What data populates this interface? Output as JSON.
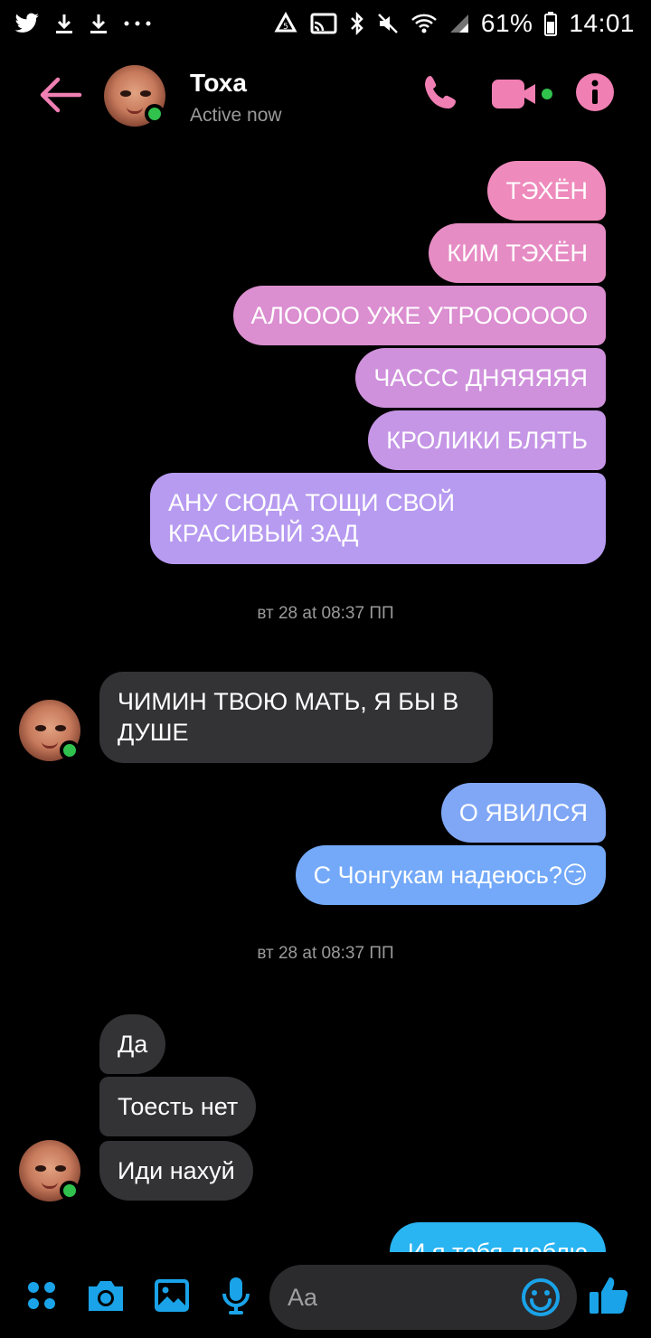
{
  "status_bar": {
    "battery": "61%",
    "time": "14:01",
    "icons": [
      "twitter-icon",
      "download-icon",
      "download-icon",
      "more-dots-icon",
      "recycle-icon",
      "cast-icon",
      "bluetooth-icon",
      "mute-icon",
      "wifi-icon",
      "signal-icon",
      "battery-icon"
    ]
  },
  "header": {
    "name": "Тоха",
    "status": "Active now"
  },
  "colors": {
    "accent": "#f07fb3",
    "incoming": "#333336",
    "online": "#31c24d",
    "composer_blue": "#1aa3e8"
  },
  "messages": {
    "m1": "ТЭХЁН",
    "m2": "КИМ ТЭХЁН",
    "m3": "АЛОООО УЖЕ УТРОООООО",
    "m4": "ЧАССС ДНЯЯЯЯЯ",
    "m5": "КРОЛИКИ БЛЯТЬ",
    "m6": "АНУ СЮДА ТОЩИ СВОЙ КРАСИВЫЙ ЗАД",
    "ts1": "вт 28 at 08:37 ПП",
    "m7": "ЧИМИН ТВОЮ МАТЬ, Я БЫ В ДУШЕ",
    "m8": "О ЯВИЛСЯ",
    "m9": "С Чонгукам надеюсь?😏",
    "ts2": "вт 28 at 08:37 ПП",
    "m10": "Да",
    "m11": "Тоесть нет",
    "m12": "Иди нахуй",
    "m13": "И я тебя люблю"
  },
  "composer": {
    "placeholder": "Aa"
  }
}
